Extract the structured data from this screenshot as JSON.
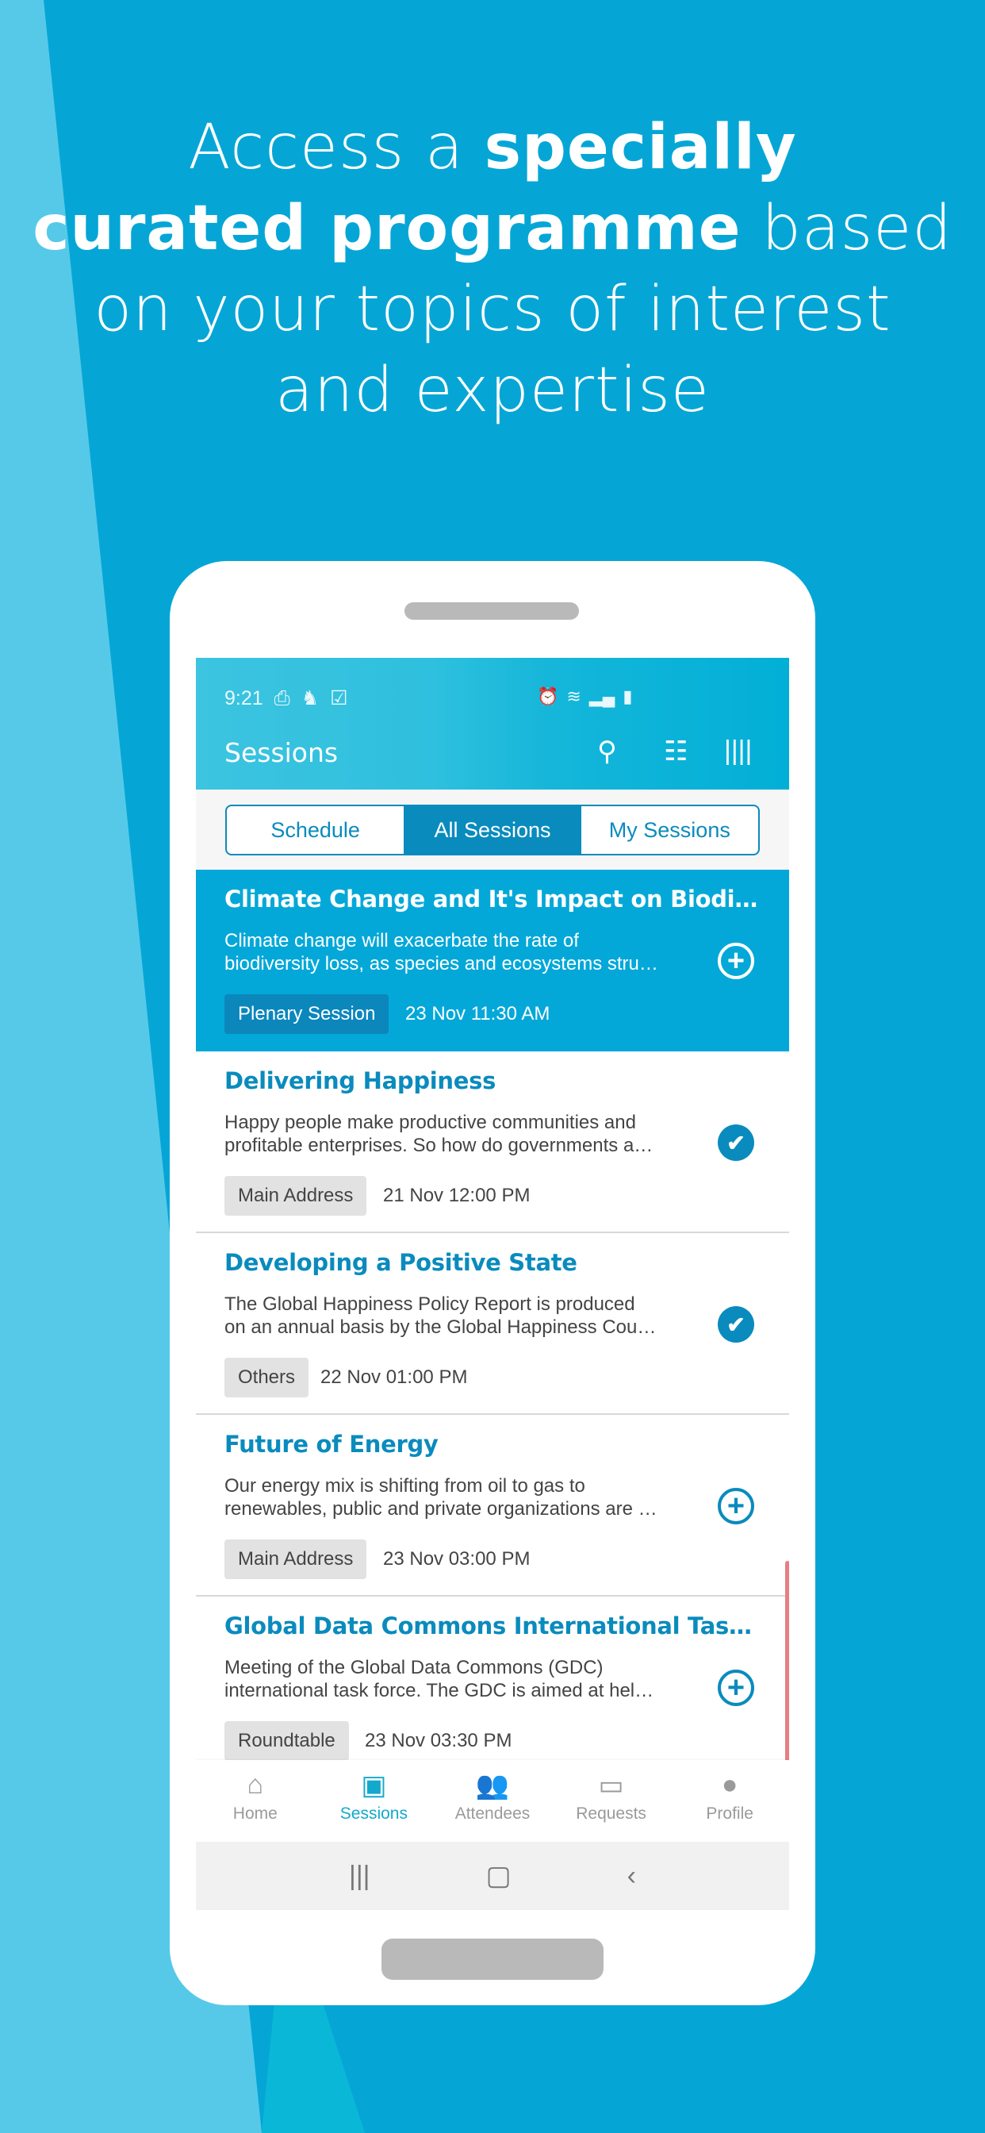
{
  "headline": {
    "l1a": "Access a ",
    "l1b": "specially",
    "l2a": "curated programme",
    "l2b": " based",
    "l3": "on your topics of interest",
    "l4": "and expertise"
  },
  "colors": {
    "background": "#05a6d6",
    "accent": "#0a8bbd",
    "highlight": "#03a8d8",
    "active_nav": "#13a9cc"
  },
  "status": {
    "time": "9:21"
  },
  "appbar": {
    "title": "Sessions",
    "icons": [
      "search-icon",
      "filter-icon",
      "audio-icon"
    ]
  },
  "tabs": [
    {
      "label": "Schedule"
    },
    {
      "label": "All Sessions",
      "active": true
    },
    {
      "label": "My Sessions"
    }
  ],
  "sessions": [
    {
      "title": "Climate Change and It's Impact on Biodi…",
      "desc1": "Climate change will exacerbate the rate of",
      "desc2": "biodiversity loss, as species and ecosystems stru…",
      "tag": "Plenary Session",
      "when": "23 Nov 11:30 AM",
      "action": "add",
      "highlighted": true
    },
    {
      "title": "Delivering Happiness",
      "desc1": "Happy people make productive communities and",
      "desc2": "profitable enterprises. So how do governments a…",
      "tag": "Main Address",
      "when": "21 Nov 12:00 PM",
      "action": "added"
    },
    {
      "title": "Developing a Positive State",
      "desc1": "The Global Happiness Policy Report is produced",
      "desc2": "on an annual basis by the Global Happiness Cou…",
      "tag": "Others",
      "when": "22 Nov 01:00 PM",
      "action": "added"
    },
    {
      "title": "Future of Energy",
      "desc1": "Our energy mix is shifting from oil to gas to",
      "desc2": "renewables, public and private organizations are …",
      "tag": "Main Address",
      "when": "23 Nov 03:00 PM",
      "action": "add"
    },
    {
      "title": "Global Data Commons International Tas…",
      "desc1": "Meeting of the Global Data Commons (GDC)",
      "desc2": "international task force. The GDC is aimed at hel…",
      "tag": "Roundtable",
      "when": "23 Nov 03:30 PM",
      "action": "add"
    }
  ],
  "nav": [
    {
      "label": "Home"
    },
    {
      "label": "Sessions",
      "active": true
    },
    {
      "label": "Attendees"
    },
    {
      "label": "Requests"
    },
    {
      "label": "Profile"
    }
  ]
}
